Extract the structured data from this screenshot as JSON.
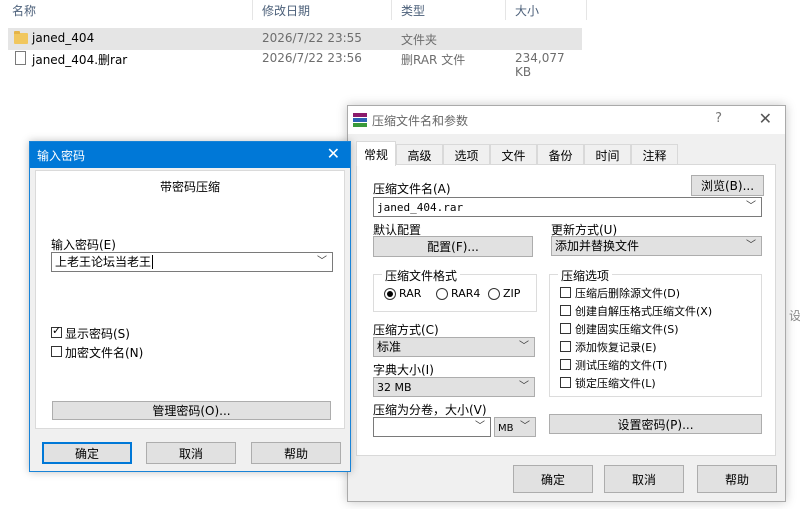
{
  "explorer": {
    "columns": {
      "name": "名称",
      "date": "修改日期",
      "type": "类型",
      "size": "大小"
    },
    "files": [
      {
        "name": "janed_404",
        "date": "2026/7/22 23:55",
        "type": "文件夹",
        "size": "",
        "icon": "folder-icon",
        "selected": true
      },
      {
        "name": "janed_404.删rar",
        "date": "2026/7/22 23:56",
        "type": "删RAR 文件",
        "size": "234,077 KB",
        "icon": "file-icon",
        "selected": false
      }
    ],
    "side_text": "设"
  },
  "password_dialog": {
    "title": "输入密码",
    "heading": "带密码压缩",
    "password_label": "输入密码(E)",
    "password_value": "上老王论坛当老王",
    "show_password_label": "显示密码(S)",
    "show_password_checked": true,
    "encrypt_names_label": "加密文件名(N)",
    "encrypt_names_checked": false,
    "manage_button": "管理密码(O)...",
    "ok_button": "确定",
    "cancel_button": "取消",
    "help_button": "帮助",
    "accent_color": "#0078d7"
  },
  "archive_dialog": {
    "title": "压缩文件名和参数",
    "help_glyph": "?",
    "tabs": [
      "常规",
      "高级",
      "选项",
      "文件",
      "备份",
      "时间",
      "注释"
    ],
    "active_tab": "常规",
    "archive_name_label": "压缩文件名(A)",
    "browse_button": "浏览(B)...",
    "archive_name_value": "janed_404.rar",
    "default_profile_label": "默认配置",
    "profile_button": "配置(F)...",
    "update_mode_label": "更新方式(U)",
    "update_mode_value": "添加并替换文件",
    "format_group_title": "压缩文件格式",
    "formats": [
      {
        "label": "RAR",
        "selected": true
      },
      {
        "label": "RAR4",
        "selected": false
      },
      {
        "label": "ZIP",
        "selected": false
      }
    ],
    "method_label": "压缩方式(C)",
    "method_value": "标准",
    "dict_label": "字典大小(I)",
    "dict_value": "32 MB",
    "split_label": "压缩为分卷，大小(V)",
    "split_value": "",
    "split_unit": "MB",
    "options_group_title": "压缩选项",
    "options": [
      {
        "label": "压缩后删除源文件(D)",
        "checked": false
      },
      {
        "label": "创建自解压格式压缩文件(X)",
        "checked": false
      },
      {
        "label": "创建固实压缩文件(S)",
        "checked": false
      },
      {
        "label": "添加恢复记录(E)",
        "checked": false
      },
      {
        "label": "测试压缩的文件(T)",
        "checked": false
      },
      {
        "label": "锁定压缩文件(L)",
        "checked": false
      }
    ],
    "set_password_button": "设置密码(P)...",
    "ok_button": "确定",
    "cancel_button": "取消",
    "help_button": "帮助"
  }
}
